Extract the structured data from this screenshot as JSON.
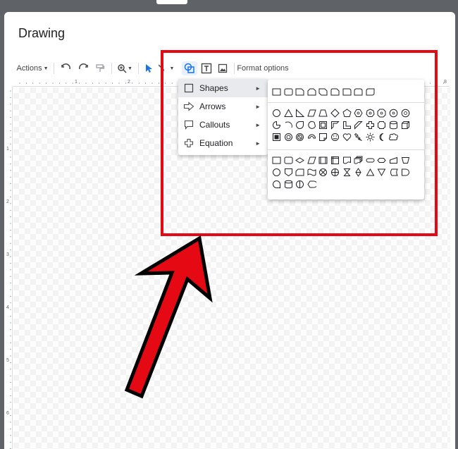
{
  "dialog": {
    "title": "Drawing"
  },
  "toolbar": {
    "actions_label": "Actions",
    "format_options_label": "Format options",
    "icons": [
      "undo-icon",
      "redo-icon",
      "paint-format-icon",
      "zoom-icon",
      "select-icon",
      "line-icon",
      "shape-icon",
      "textbox-icon",
      "image-icon"
    ]
  },
  "ruler": {
    "horizontal_numbers": [
      "1",
      "2",
      "3",
      "8"
    ],
    "vertical_numbers": [
      "1",
      "2",
      "3",
      "4",
      "5",
      "6"
    ]
  },
  "shape_menu": {
    "items": [
      {
        "label": "Shapes",
        "icon": "square-icon",
        "highlighted": true
      },
      {
        "label": "Arrows",
        "icon": "arrow-right-icon",
        "highlighted": false
      },
      {
        "label": "Callouts",
        "icon": "callout-icon",
        "highlighted": false
      },
      {
        "label": "Equation",
        "icon": "plus-icon",
        "highlighted": false
      }
    ]
  },
  "shapes_submenu": {
    "groups": [
      "rectangles",
      "basic-shapes",
      "flowchart"
    ]
  },
  "colors": {
    "annotation_red": "#e50914",
    "highlight_bg": "#e8eaed",
    "accent_blue": "#1a73e8"
  }
}
